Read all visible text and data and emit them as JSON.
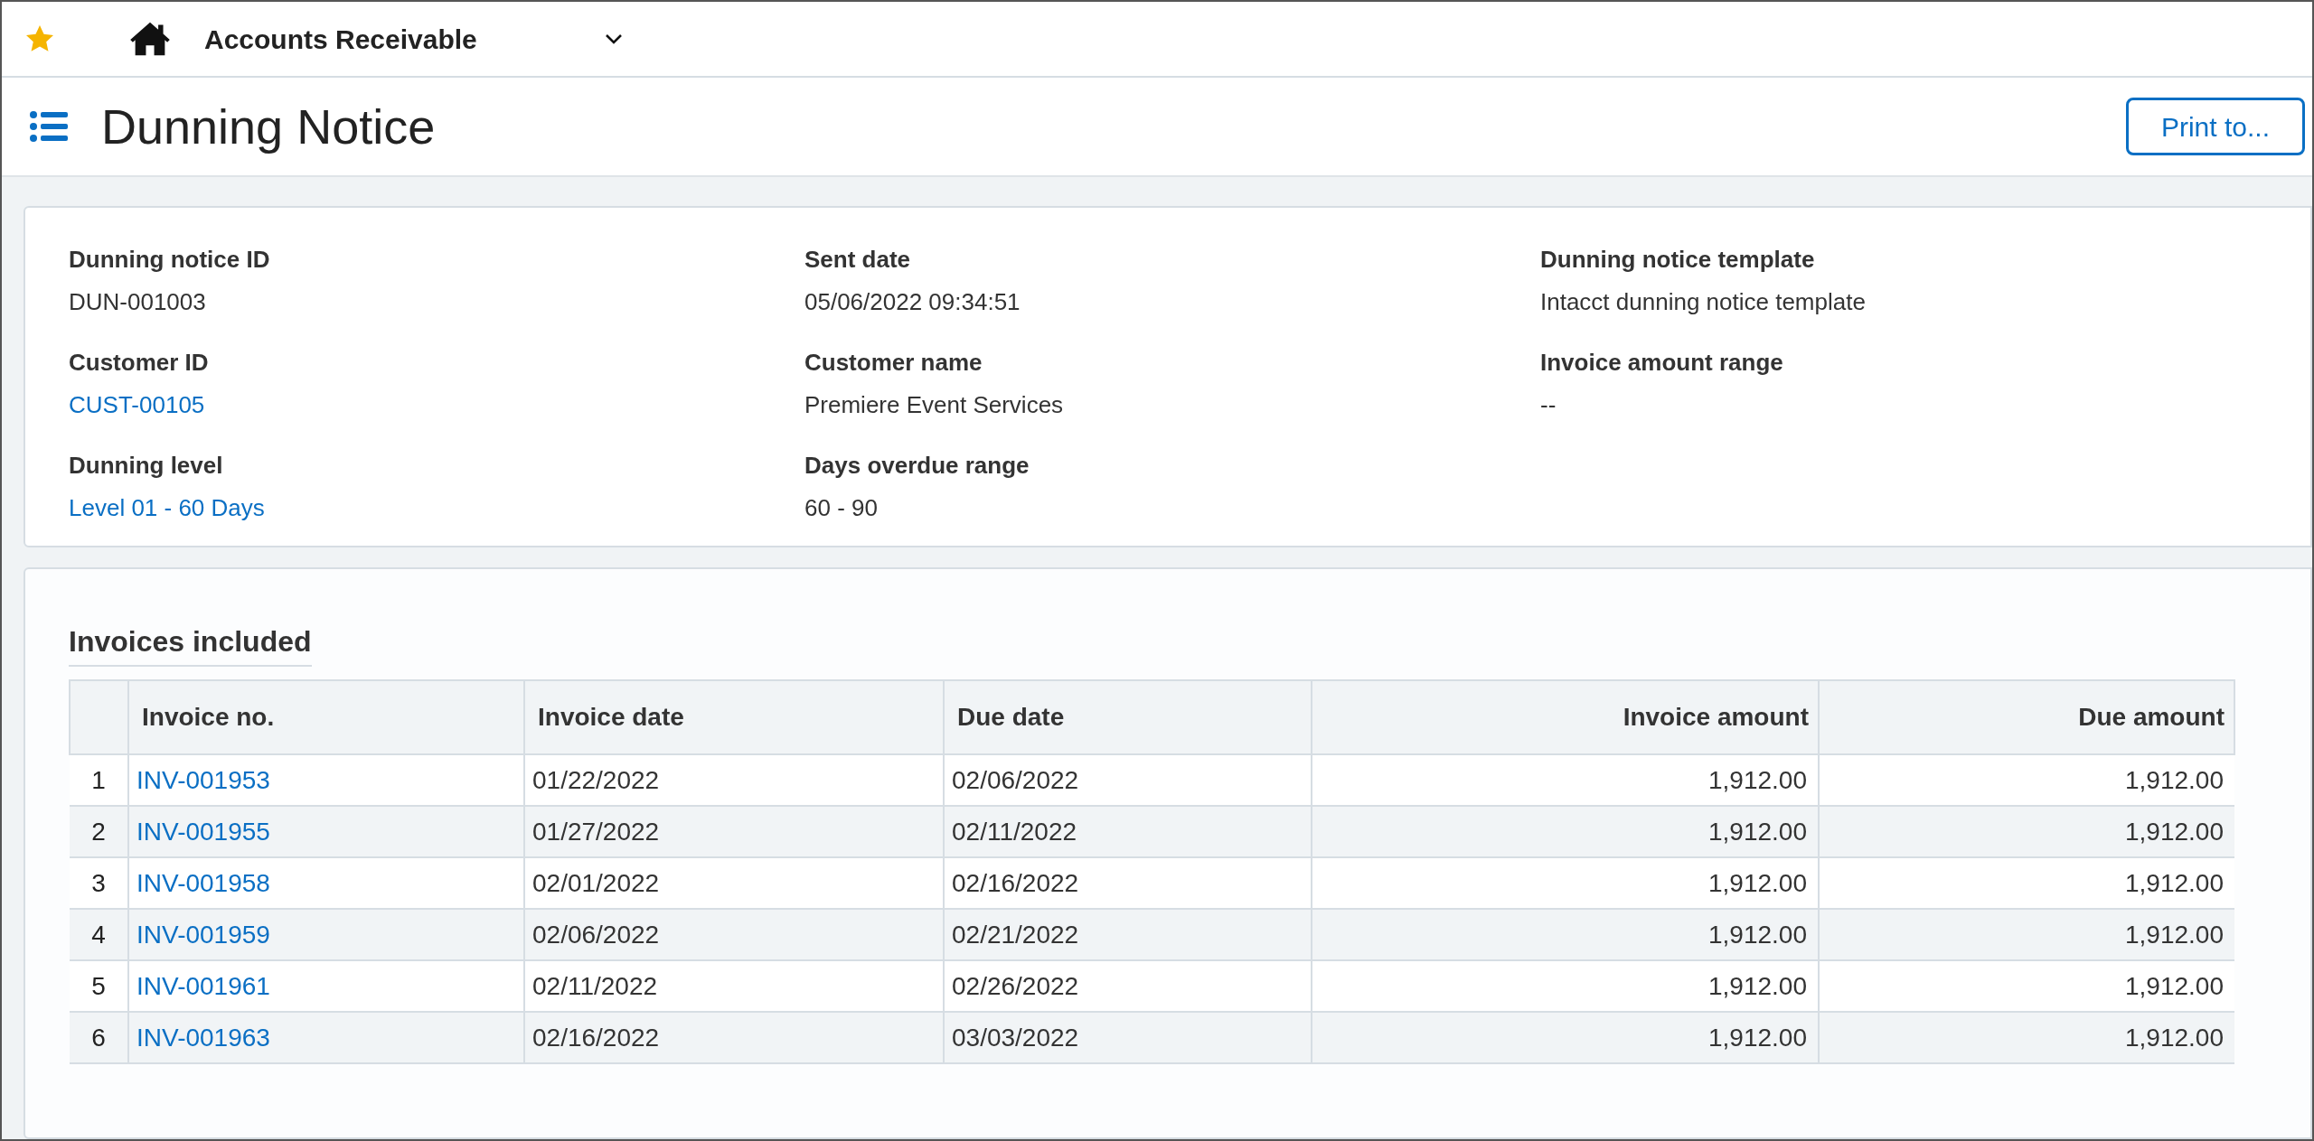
{
  "top_bar": {
    "module": "Accounts Receivable"
  },
  "header": {
    "title": "Dunning Notice",
    "print_button": "Print to..."
  },
  "details": {
    "columns": [
      [
        {
          "label": "Dunning notice ID",
          "value": "DUN-001003",
          "link": false
        },
        {
          "label": "Customer ID",
          "value": "CUST-00105",
          "link": true
        },
        {
          "label": "Dunning level",
          "value": "Level 01 - 60 Days",
          "link": true
        }
      ],
      [
        {
          "label": "Sent date",
          "value": "05/06/2022 09:34:51",
          "link": false
        },
        {
          "label": "Customer name",
          "value": "Premiere Event Services",
          "link": false
        },
        {
          "label": "Days overdue range",
          "value": "60 - 90",
          "link": false
        }
      ],
      [
        {
          "label": "Dunning notice template",
          "value": "Intacct dunning notice template",
          "link": false
        },
        {
          "label": "Invoice amount range",
          "value": "--",
          "link": false
        }
      ]
    ]
  },
  "invoices": {
    "title": "Invoices included",
    "columns": [
      "Invoice no.",
      "Invoice date",
      "Due date",
      "Invoice amount",
      "Due amount"
    ],
    "rows": [
      {
        "n": "1",
        "invoice_no": "INV-001953",
        "invoice_date": "01/22/2022",
        "due_date": "02/06/2022",
        "invoice_amount": "1,912.00",
        "due_amount": "1,912.00"
      },
      {
        "n": "2",
        "invoice_no": "INV-001955",
        "invoice_date": "01/27/2022",
        "due_date": "02/11/2022",
        "invoice_amount": "1,912.00",
        "due_amount": "1,912.00"
      },
      {
        "n": "3",
        "invoice_no": "INV-001958",
        "invoice_date": "02/01/2022",
        "due_date": "02/16/2022",
        "invoice_amount": "1,912.00",
        "due_amount": "1,912.00"
      },
      {
        "n": "4",
        "invoice_no": "INV-001959",
        "invoice_date": "02/06/2022",
        "due_date": "02/21/2022",
        "invoice_amount": "1,912.00",
        "due_amount": "1,912.00"
      },
      {
        "n": "5",
        "invoice_no": "INV-001961",
        "invoice_date": "02/11/2022",
        "due_date": "02/26/2022",
        "invoice_amount": "1,912.00",
        "due_amount": "1,912.00"
      },
      {
        "n": "6",
        "invoice_no": "INV-001963",
        "invoice_date": "02/16/2022",
        "due_date": "03/03/2022",
        "invoice_amount": "1,912.00",
        "due_amount": "1,912.00"
      }
    ]
  }
}
